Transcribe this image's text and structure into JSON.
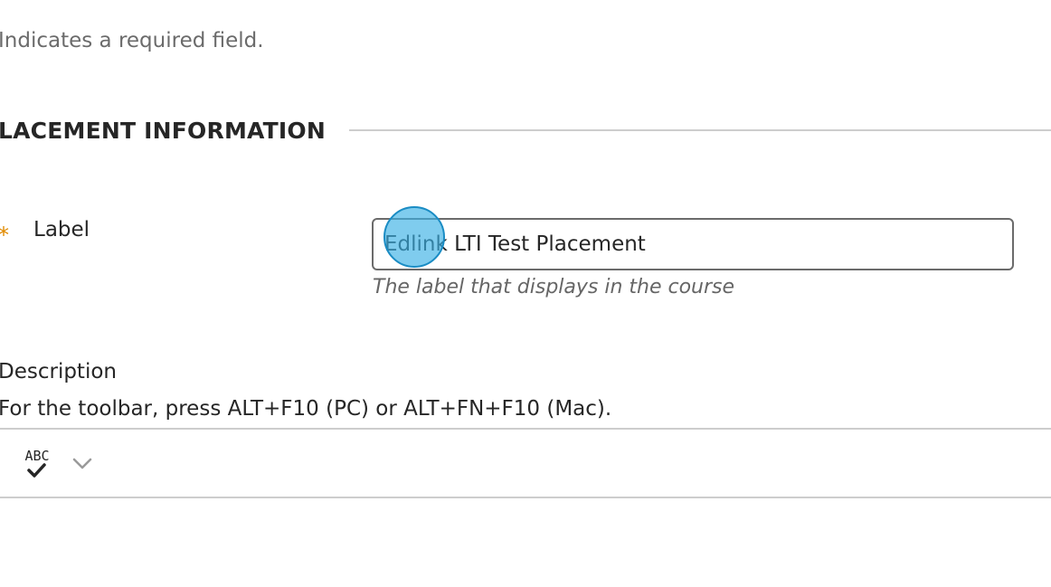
{
  "required_note": "Indicates a required field.",
  "section": {
    "title": "LACEMENT INFORMATION"
  },
  "label_field": {
    "required_marker": "*",
    "label": "Label",
    "value": "Edlink LTI Test Placement",
    "help": "The label that displays in the course"
  },
  "description": {
    "label": "Description",
    "toolbar_hint": "For the toolbar, press ALT+F10 (PC) or ALT+FN+F10 (Mac)."
  },
  "editor_toolbar": {
    "spellcheck_icon_text": "ABC",
    "icons": [
      "spellcheck-icon",
      "chevron-down-icon"
    ]
  },
  "colors": {
    "required_star": "#e08a00",
    "click_marker": "#3ab0e5",
    "rule": "#cdcdcd"
  }
}
